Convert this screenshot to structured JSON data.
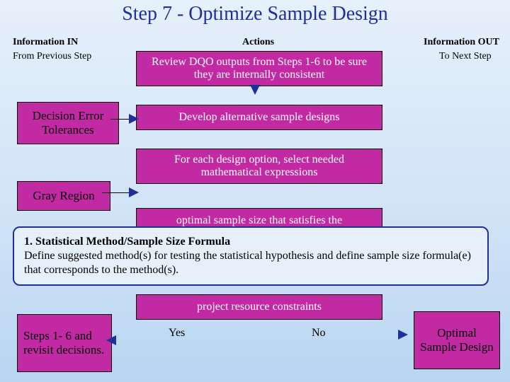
{
  "title": "Step 7 - Optimize Sample Design",
  "sections": {
    "info_in": "Information IN",
    "actions": "Actions",
    "info_out": "Information OUT",
    "from_prev": "From Previous Step",
    "to_next": "To Next Step"
  },
  "inputs": {
    "det": "Decision Error Tolerances",
    "gray": "Gray Region",
    "loopback": "Steps 1- 6 and revisit decisions."
  },
  "actions_list": {
    "a1": "Review DQO outputs from Steps 1-6 to be sure they are internally consistent",
    "a2": "Develop alternative sample designs",
    "a3": "For each design option, select needed mathematical expressions",
    "a4": "optimal sample size that satisfies the",
    "a5": "project resource constraints"
  },
  "decision": {
    "yes": "Yes",
    "no": "No"
  },
  "output": {
    "opt": "Optimal Sample Design"
  },
  "callout": {
    "lead": "1.  Statistical Method/Sample Size Formula",
    "body": "Define suggested method(s) for testing the statistical hypothesis and define sample size formula(e) that corresponds to the method(s)."
  }
}
